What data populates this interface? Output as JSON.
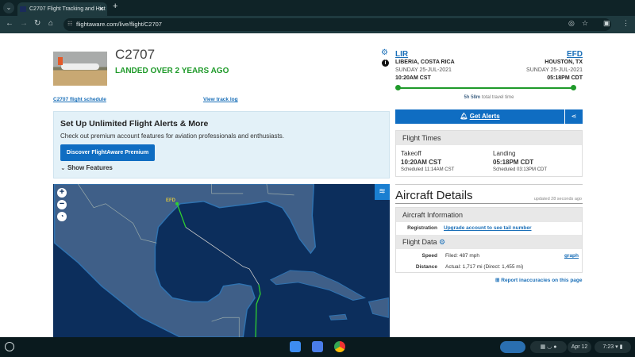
{
  "browser": {
    "tab_title": "C2707 Flight Tracking and Hist",
    "url": "flightaware.com/live/flight/C2707"
  },
  "flight": {
    "ident": "C2707",
    "status": "LANDED OVER 2 YEARS AGO",
    "schedule_link": "C2707 flight schedule",
    "track_log_link": "View track log"
  },
  "promo": {
    "title": "Set Up Unlimited Flight Alerts & More",
    "text": "Check out premium account features for aviation professionals and enthusiasts.",
    "button": "Discover FlightAware Premium",
    "show_features": "Show Features"
  },
  "map": {
    "airport_label": "EFD"
  },
  "origin": {
    "code": "LIR",
    "city": "LIBERIA, COSTA RICA",
    "date": "SUNDAY 25-JUL-2021",
    "time": "10:20AM CST"
  },
  "destination": {
    "code": "EFD",
    "city": "HOUSTON, TX",
    "date": "SUNDAY 25-JUL-2021",
    "time": "05:18PM CDT"
  },
  "travel": {
    "duration": "5h 58m",
    "suffix": "total travel time"
  },
  "alerts": {
    "button": "Get Alerts"
  },
  "flight_times": {
    "header": "Flight Times",
    "takeoff_label": "Takeoff",
    "takeoff_time": "10:20AM CST",
    "takeoff_sched": "Scheduled 11:14AM CST",
    "landing_label": "Landing",
    "landing_time": "05:18PM CDT",
    "landing_sched": "Scheduled 03:13PM CDT"
  },
  "aircraft": {
    "title": "Aircraft Details",
    "updated": "updated 28 seconds ago",
    "info_header": "Aircraft Information",
    "registration_label": "Registration",
    "registration_value": "Upgrade account to see tail number",
    "flight_data_header": "Flight Data",
    "speed_label": "Speed",
    "speed_value": "Filed: 487 mph",
    "graph_link": "graph",
    "distance_label": "Distance",
    "distance_value": "Actual: 1,717 mi (Direct: 1,455 mi)",
    "report": "Report inaccuracies on this page"
  },
  "shelf": {
    "date": "Apr 12",
    "time": "7:23"
  }
}
